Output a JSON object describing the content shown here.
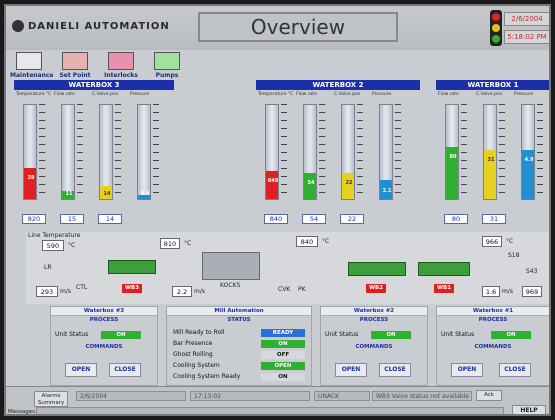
{
  "app": {
    "logo": "DANIELI AUTOMATION",
    "title": "Overview",
    "date": "2/6/2004",
    "time": "5:18:02 PM"
  },
  "nav": [
    {
      "label": "Maintenance",
      "icon": "maintenance-icon"
    },
    {
      "label": "Set Point",
      "icon": "setpoint-icon"
    },
    {
      "label": "Interlocks",
      "icon": "interlocks-icon"
    },
    {
      "label": "Pumps",
      "icon": "pumps-icon"
    }
  ],
  "waterboxes": [
    {
      "title": "WATERBOX 3",
      "gauges": [
        {
          "label": "Temperature °C",
          "value": "38",
          "level": 0.33,
          "color": "#e02020"
        },
        {
          "label": "Flow rate",
          "value": "11",
          "level": 0.08,
          "color": "#30b030"
        },
        {
          "label": "C.Valve pos",
          "value": "14",
          "level": 0.14,
          "color": "#e6d020"
        },
        {
          "label": "Pressure",
          "value": "0.4",
          "level": 0.04,
          "color": "#2090d0"
        }
      ],
      "readouts": [
        "820",
        "15",
        "14"
      ]
    },
    {
      "title": "WATERBOX 2",
      "gauges": [
        {
          "label": "Temperature °C",
          "value": "848",
          "level": 0.3,
          "color": "#e02020"
        },
        {
          "label": "Flow rate",
          "value": "54",
          "level": 0.28,
          "color": "#30b030"
        },
        {
          "label": "C.Valve pos",
          "value": "22",
          "level": 0.28,
          "color": "#e6d020"
        },
        {
          "label": "Pressure",
          "value": "2.1",
          "level": 0.2,
          "color": "#2090d0"
        }
      ],
      "readouts": [
        "840",
        "54",
        "22"
      ]
    },
    {
      "title": "WATERBOX 1",
      "gauges": [
        {
          "label": "Flow rate",
          "value": "80",
          "level": 0.55,
          "color": "#30b030"
        },
        {
          "label": "C.Valve pos",
          "value": "31",
          "level": 0.52,
          "color": "#e6d020"
        },
        {
          "label": "Pressure",
          "value": "4.9",
          "level": 0.52,
          "color": "#2090d0"
        }
      ],
      "readouts": [
        "80",
        "31"
      ]
    }
  ],
  "mill": {
    "header": "Line Temperature",
    "t1_value": "590",
    "t1_unit": "°C",
    "t2_value": "810",
    "t2_unit": "°C",
    "t3_value": "840",
    "t3_unit": "°C",
    "t4_value": "966",
    "t4_unit": "°C",
    "lr_label": "LR",
    "speed1": "293",
    "speed1_unit": "m/s",
    "ctl_label": "CTL",
    "speed2": "2.2",
    "speed2_unit": "m/s",
    "kocks_label": "KOCKS",
    "cvk_label": "CVK",
    "pk_label": "PK",
    "s18_label": "S18",
    "s43_label": "S43",
    "speed3": "1.6",
    "speed3_unit": "m/s",
    "speed4": "969",
    "wb3": "WB3",
    "wb2": "WB2",
    "wb1": "WB1"
  },
  "panels": {
    "wb3": {
      "title": "Waterbox #3",
      "sub": "PROCESS",
      "status_label": "Unit Status",
      "status": "ON",
      "cmd": "COMMANDS",
      "open": "OPEN",
      "close": "CLOSE"
    },
    "mill": {
      "title": "Mill Automation",
      "sub": "STATUS",
      "rows": [
        {
          "label": "Mill Ready to Roll",
          "value": "READY",
          "color": "#2a6fd8"
        },
        {
          "label": "Bar Presence",
          "value": "ON",
          "color": "#30b030"
        },
        {
          "label": "Ghost Rolling",
          "value": "OFF",
          "color": "#d6d8db"
        },
        {
          "label": "Cooling System",
          "value": "OPEN",
          "color": "#30b030"
        },
        {
          "label": "Cooling System Ready",
          "value": "ON",
          "color": "#d6d8db"
        }
      ]
    },
    "wb2": {
      "title": "Waterbox #2",
      "sub": "PROCESS",
      "status_label": "Unit Status",
      "status": "ON",
      "cmd": "COMMANDS",
      "open": "OPEN",
      "close": "CLOSE"
    },
    "wb1": {
      "title": "Waterbox #1",
      "sub": "PROCESS",
      "status_label": "Unit Status",
      "status": "ON",
      "cmd": "COMMANDS",
      "open": "OPEN",
      "close": "CLOSE"
    }
  },
  "footer": {
    "alarms": "Alarms Summary",
    "date": "2/6/2004",
    "time": "17:13:02",
    "state": "UNACK",
    "message": "WB3 Valve status not available",
    "ack": "Ack",
    "messages_label": "Messages",
    "help": "HELP"
  }
}
